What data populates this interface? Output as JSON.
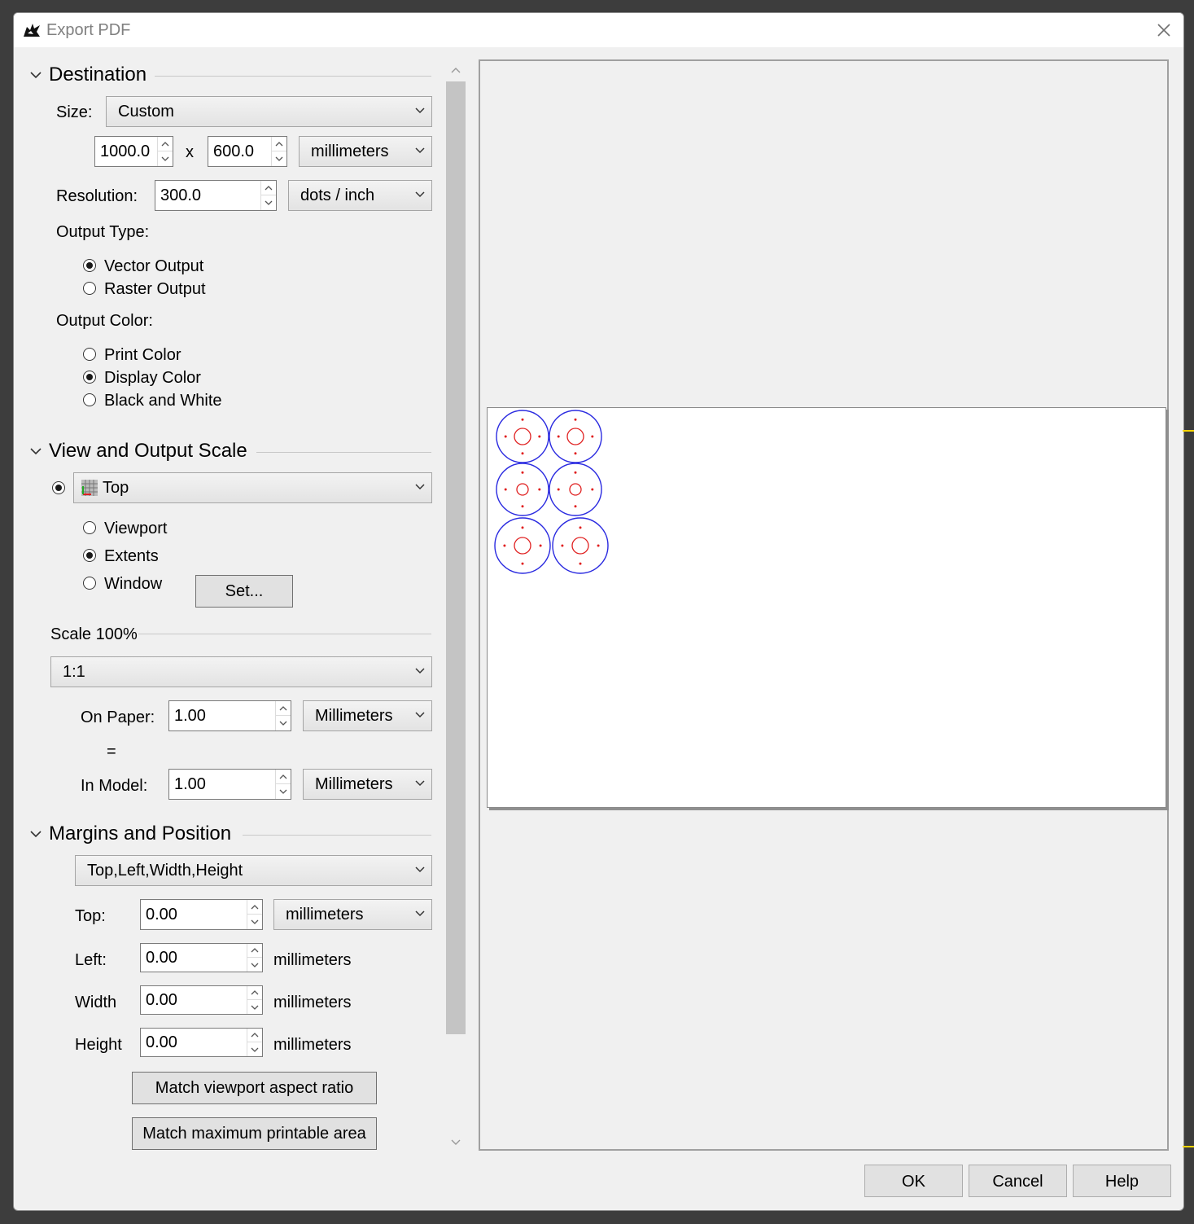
{
  "window": {
    "title": "Export PDF",
    "close": "✕"
  },
  "destination": {
    "title": "Destination",
    "size_label": "Size:",
    "size_value": "Custom",
    "width": "1000.0",
    "times": "x",
    "height": "600.0",
    "size_unit": "millimeters",
    "resolution_label": "Resolution:",
    "resolution": "300.0",
    "resolution_unit": "dots / inch",
    "output_type_label": "Output Type:",
    "output_types": [
      "Vector Output",
      "Raster Output"
    ],
    "output_type_selected": "Vector Output",
    "output_color_label": "Output Color:",
    "output_colors": [
      "Print Color",
      "Display Color",
      "Black and White"
    ],
    "output_color_selected": "Display Color"
  },
  "view": {
    "title": "View and Output Scale",
    "view_value": "Top",
    "options": [
      "Viewport",
      "Extents",
      "Window"
    ],
    "selected": "Extents",
    "set_button": "Set...",
    "scale_title": "Scale 100%",
    "scale_value": "1:1",
    "on_paper_label": "On Paper:",
    "on_paper": "1.00",
    "on_paper_unit": "Millimeters",
    "equals": "=",
    "in_model_label": "In Model:",
    "in_model": "1.00",
    "in_model_unit": "Millimeters"
  },
  "margins": {
    "title": "Margins and Position",
    "mode": "Top,Left,Width,Height",
    "top_label": "Top:",
    "top": "0.00",
    "top_unit": "millimeters",
    "left_label": "Left:",
    "left": "0.00",
    "left_unit": "millimeters",
    "width_label": "Width",
    "width": "0.00",
    "width_unit": "millimeters",
    "height_label": "Height",
    "height": "0.00",
    "height_unit": "millimeters",
    "match_viewport": "Match viewport aspect ratio",
    "match_max": "Match maximum printable area"
  },
  "footer": {
    "ok": "OK",
    "cancel": "Cancel",
    "help": "Help"
  },
  "colors": {
    "outer_circle": "#2a2ae0",
    "inner_circle": "#e02020",
    "accent": "#f5d400"
  }
}
